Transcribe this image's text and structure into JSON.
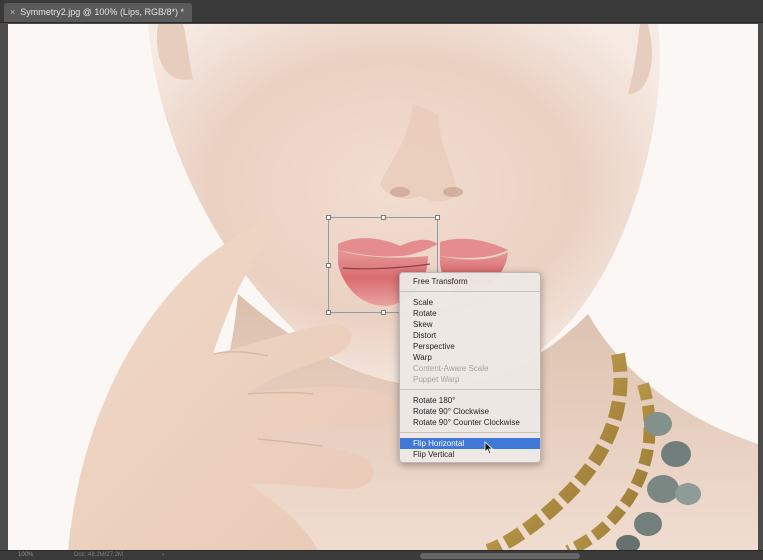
{
  "window": {
    "tab_title": "Symmetry2.jpg @ 100% (Lips, RGB/8*) *",
    "close_glyph": "×"
  },
  "status": {
    "zoom": "100%",
    "doc_info": "Doc: 48.2M/27.2M",
    "arrow_glyph": "›"
  },
  "context_menu": {
    "items": [
      {
        "label": "Free Transform",
        "state": "normal"
      },
      {
        "label": "Scale",
        "state": "normal"
      },
      {
        "label": "Rotate",
        "state": "normal"
      },
      {
        "label": "Skew",
        "state": "normal"
      },
      {
        "label": "Distort",
        "state": "normal"
      },
      {
        "label": "Perspective",
        "state": "normal"
      },
      {
        "label": "Warp",
        "state": "normal"
      },
      {
        "label": "Content-Aware Scale",
        "state": "disabled"
      },
      {
        "label": "Puppet Warp",
        "state": "disabled"
      },
      {
        "label": "Rotate 180°",
        "state": "normal"
      },
      {
        "label": "Rotate 90° Clockwise",
        "state": "normal"
      },
      {
        "label": "Rotate 90° Counter Clockwise",
        "state": "normal"
      },
      {
        "label": "Flip Horizontal",
        "state": "highlighted"
      },
      {
        "label": "Flip Vertical",
        "state": "normal"
      }
    ]
  },
  "colors": {
    "menu_highlight": "#3f78d6",
    "transform_box": "#8b9bb0",
    "chrome_dark": "#3a3a3a"
  }
}
